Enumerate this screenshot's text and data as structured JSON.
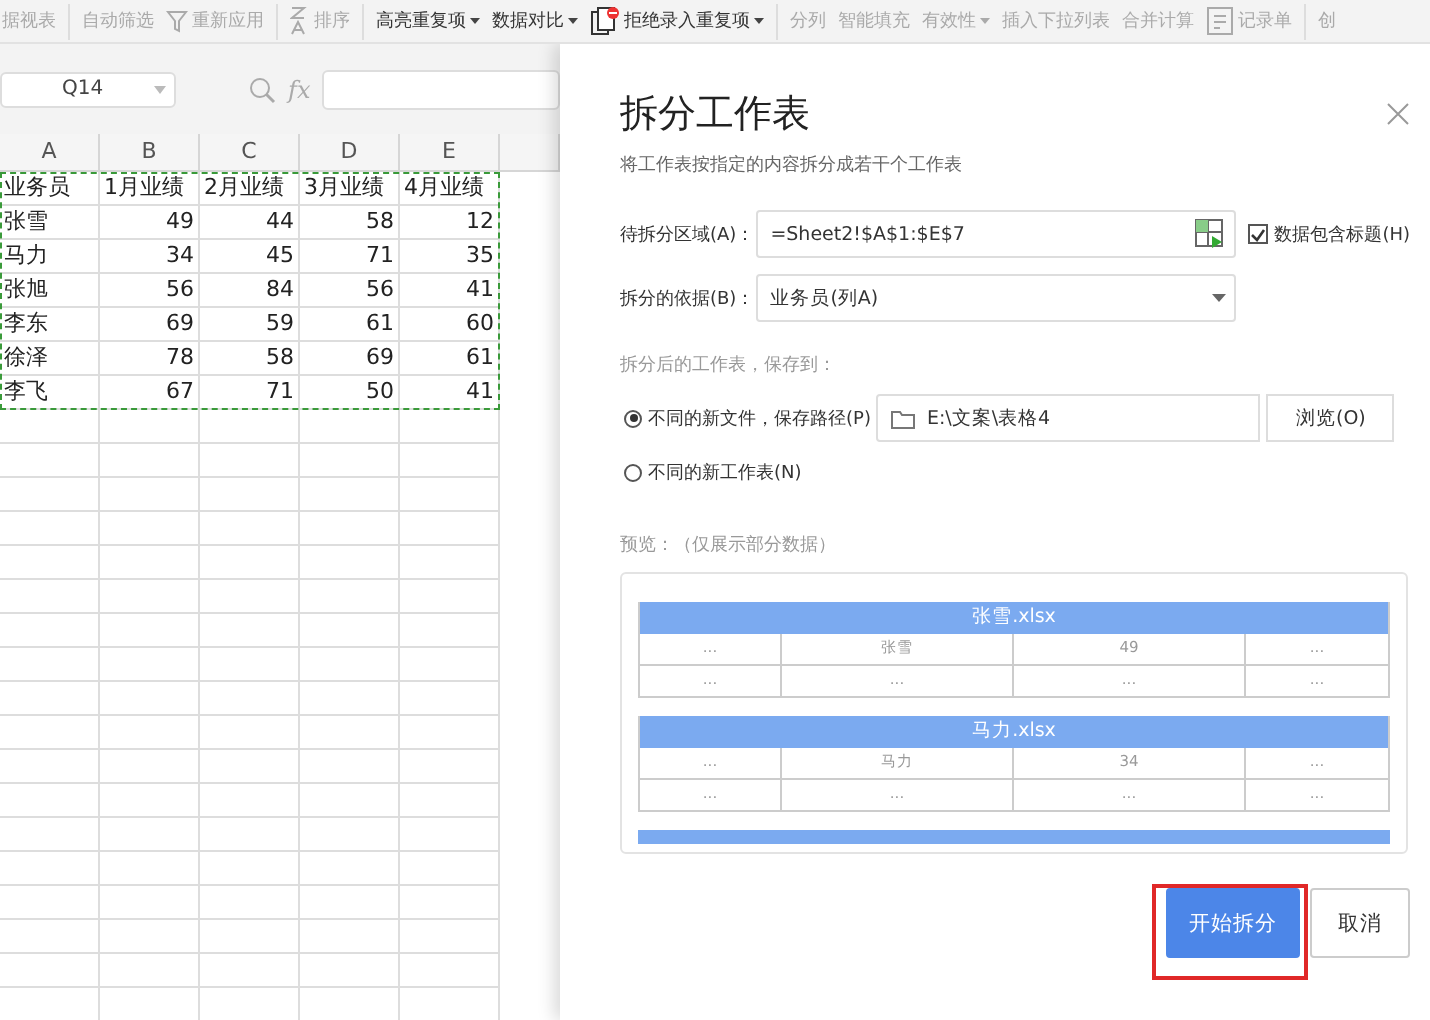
{
  "toolbar": {
    "groups": [
      {
        "items": [
          {
            "label": "据视表",
            "disabled": true,
            "dropdown": false,
            "kind": "text"
          }
        ]
      },
      {
        "items": [
          {
            "label": "自动筛选",
            "disabled": true,
            "dropdown": false,
            "kind": "text"
          },
          {
            "label": "重新应用",
            "disabled": true,
            "dropdown": false,
            "kind": "filter"
          }
        ]
      },
      {
        "items": [
          {
            "label": "排序",
            "disabled": true,
            "dropdown": false,
            "kind": "sort"
          }
        ]
      },
      {
        "items": [
          {
            "label": "高亮重复项",
            "disabled": false,
            "dropdown": true,
            "kind": "text"
          },
          {
            "label": "数据对比",
            "disabled": false,
            "dropdown": true,
            "kind": "text"
          },
          {
            "label": "拒绝录入重复项",
            "disabled": false,
            "dropdown": true,
            "kind": "reject"
          }
        ]
      },
      {
        "items": [
          {
            "label": "分列",
            "disabled": true,
            "dropdown": false,
            "kind": "text"
          },
          {
            "label": "智能填充",
            "disabled": true,
            "dropdown": false,
            "kind": "text"
          },
          {
            "label": "有效性",
            "disabled": true,
            "dropdown": true,
            "kind": "text"
          },
          {
            "label": "插入下拉列表",
            "disabled": true,
            "dropdown": false,
            "kind": "text"
          },
          {
            "label": "合并计算",
            "disabled": true,
            "dropdown": false,
            "kind": "text"
          },
          {
            "label": "记录单",
            "disabled": true,
            "dropdown": false,
            "kind": "form"
          }
        ]
      },
      {
        "items": [
          {
            "label": "创",
            "disabled": true,
            "dropdown": false,
            "kind": "text"
          }
        ]
      }
    ]
  },
  "sheet": {
    "name_box": "Q14",
    "formula_label": "fx",
    "columns": [
      "A",
      "B",
      "C",
      "D",
      "E"
    ],
    "copy_marquee": true,
    "rows": [
      [
        "业务员",
        "1月业绩",
        "2月业绩",
        "3月业绩",
        "4月业绩"
      ],
      [
        "张雪",
        "49",
        "44",
        "58",
        "12"
      ],
      [
        "马力",
        "34",
        "45",
        "71",
        "35"
      ],
      [
        "张旭",
        "56",
        "84",
        "56",
        "41"
      ],
      [
        "李东",
        "69",
        "59",
        "61",
        "60"
      ],
      [
        "徐泽",
        "78",
        "58",
        "69",
        "61"
      ],
      [
        "李飞",
        "67",
        "71",
        "50",
        "41"
      ]
    ]
  },
  "dialog": {
    "title": "拆分工作表",
    "subtitle": "将工作表按指定的内容拆分成若干个工作表",
    "range": {
      "label": "待拆分区域(A)：",
      "value": "=Sheet2!$A$1:$E$7"
    },
    "has_header": {
      "label": "数据包含标题(H)",
      "checked": true
    },
    "split_by": {
      "label": "拆分的依据(B)：",
      "value": "业务员(列A)"
    },
    "save_label": "拆分后的工作表，保存到：",
    "save_options": [
      {
        "label": "不同的新文件，保存路径(P)",
        "selected": true,
        "kind": "path",
        "path": "E:\\文案\\表格4",
        "browse": "浏览(O)"
      },
      {
        "label": "不同的新工作表(N)",
        "selected": false,
        "kind": "plain"
      }
    ],
    "preview_label": "预览：（仅展示部分数据）",
    "preview": {
      "tables": [
        {
          "title": "张雪.xlsx",
          "rows": [
            [
              "...",
              "张雪",
              "49",
              "..."
            ],
            [
              "...",
              "...",
              "...",
              "..."
            ]
          ]
        },
        {
          "title": "马力.xlsx",
          "rows": [
            [
              "...",
              "马力",
              "34",
              "..."
            ],
            [
              "...",
              "...",
              "...",
              "..."
            ]
          ]
        }
      ],
      "more": true
    },
    "buttons": [
      {
        "label": "开始拆分",
        "primary": true,
        "highlighted": true
      },
      {
        "label": "取消",
        "primary": false,
        "highlighted": false
      }
    ]
  }
}
